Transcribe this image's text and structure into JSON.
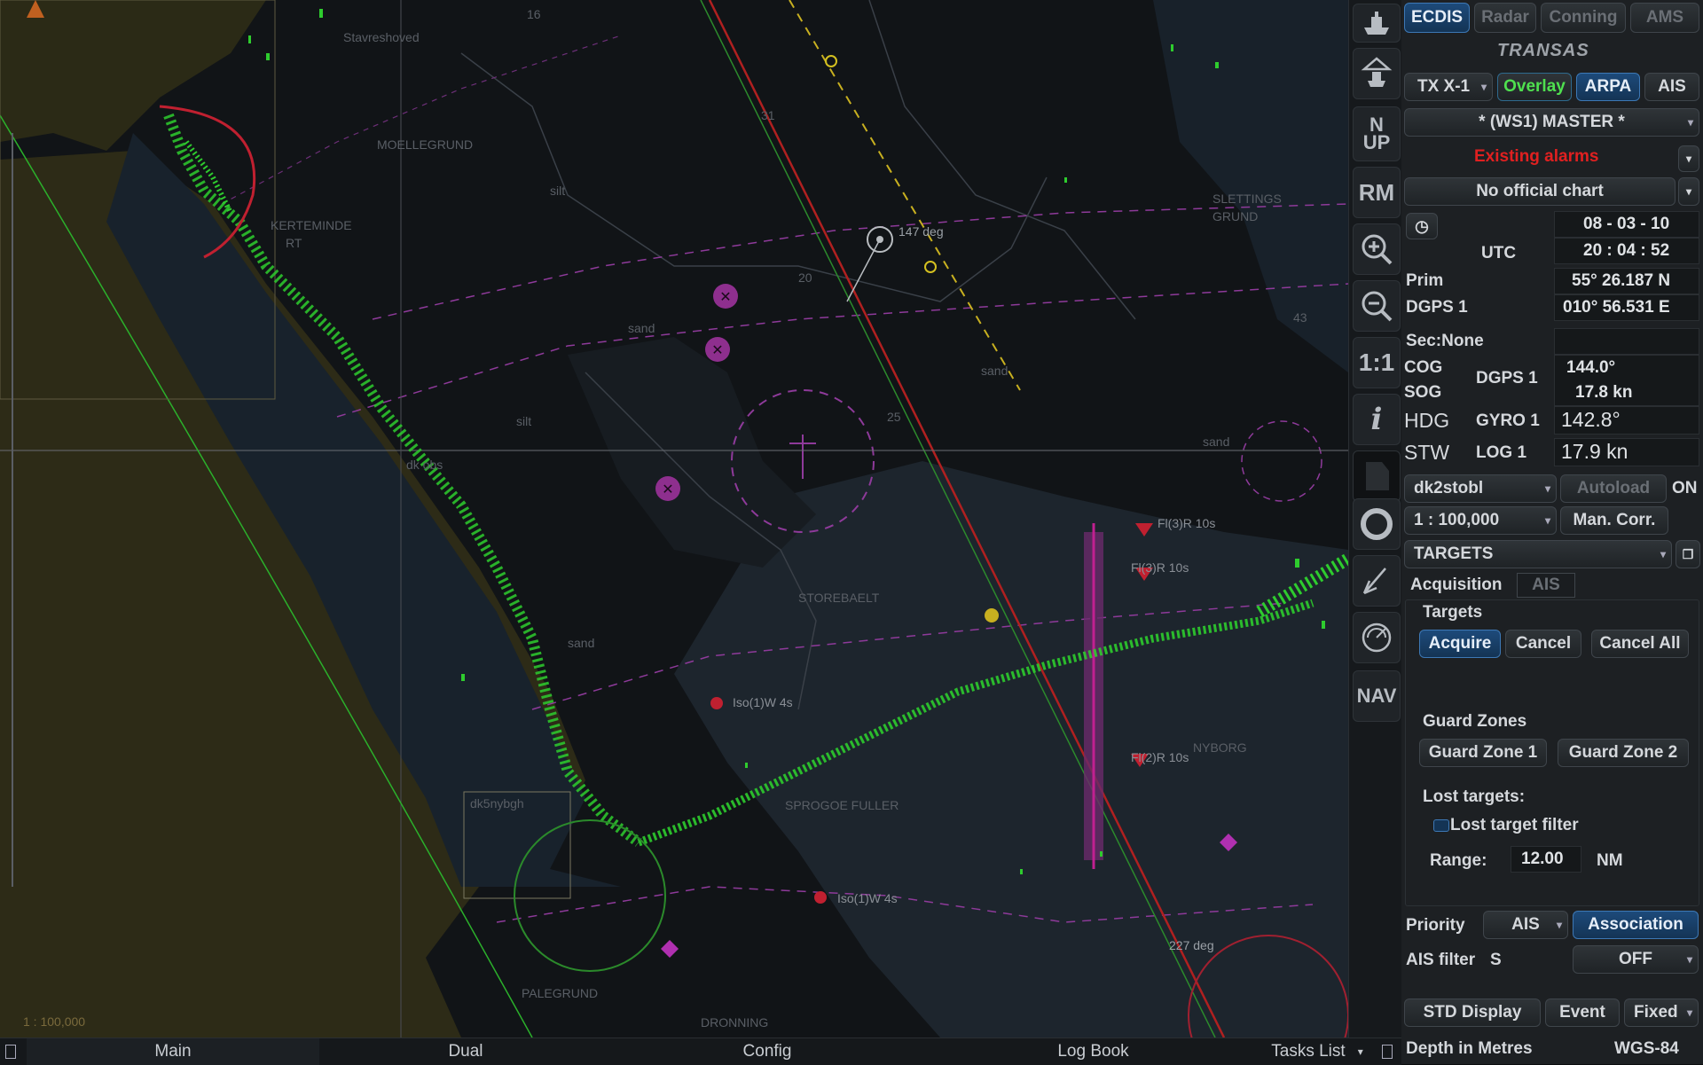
{
  "map": {
    "scale_text": "1 : 100,000",
    "labels": {
      "stavreshoved": "Stavreshoved",
      "moellegrund": "MOELLEGRUND",
      "kerteminde": "KERTEMINDE",
      "kerteminde_2": "RT",
      "silt1": "silt",
      "silt2": "silt",
      "sand1": "sand",
      "sand2": "sand",
      "sand3": "sand",
      "sand4": "sand",
      "storebaelt": "STOREBAELT",
      "sletting": "SLETTINGS",
      "sletting2": "GRUND",
      "dk_obs": "dk obs",
      "dk5nybgh": "dk5nybgh",
      "palegrund": "PALEGRUND",
      "dronning": "DRONNING",
      "deg147": "147 deg",
      "deg227": "227 deg",
      "nyeborg": "NYBORG",
      "sprogoe": "SPROGOE FULLER",
      "iso1": "Iso(1)W 4s",
      "iso2": "Iso(1)W 4s",
      "fl1": "Fl(3)R 10s",
      "fl2": "Fl(3)R 10s",
      "fl3": "Fl(2)R 10s",
      "depth_16": "16",
      "depth_31": "31",
      "depth_20": "20",
      "depth_25": "25",
      "depth_43": "43"
    }
  },
  "toolstrip": {
    "ship_icon": "ship-icon",
    "ship_home_icon": "ship-home-icon",
    "north_up": "N\nUP",
    "rm": "RM",
    "zoom_in_icon": "zoom-in-icon",
    "zoom_out_icon": "zoom-out-icon",
    "one_to_one": "1:1",
    "info": "i",
    "chart_icon": "chart-icon",
    "lifebuoy_icon": "lifebuoy-icon",
    "pencil_icon": "pencil-icon",
    "radar_icon": "radar-icon",
    "nav": "NAV"
  },
  "panel": {
    "modes": [
      "ECDIS",
      "Radar",
      "Conning",
      "AMS"
    ],
    "brand": "TRANSAS",
    "radar_source": "TX X-1",
    "overlay": "Overlay",
    "arpa": "ARPA",
    "ais": "AIS",
    "master": "* (WS1) MASTER *",
    "alarms": "Existing alarms",
    "chart_status": "No official chart",
    "date": "08 - 03 - 10",
    "utc_label": "UTC",
    "time": "20 : 04 : 52",
    "prim_label": "Prim",
    "lat": "55° 26.187 N",
    "dgps_label": "DGPS 1",
    "lon": "010° 56.531 E",
    "sec_label": "Sec:None",
    "cog_label": "COG",
    "sog_label": "SOG",
    "cogsog_src": "DGPS 1",
    "cog_val": "144.0°",
    "sog_val": "17.8 kn",
    "hdg_label": "HDG",
    "hdg_src": "GYRO 1",
    "hdg_val": "142.8°",
    "stw_label": "STW",
    "stw_src": "LOG 1",
    "stw_val": "17.9 kn",
    "chart_name": "dk2stobl",
    "autoload": "Autoload",
    "autoload_state": "ON",
    "scale": "1 : 100,000",
    "man_corr": "Man. Corr.",
    "targets_dd": "TARGETS",
    "tab_acq": "Acquisition",
    "tab_ais": "AIS",
    "targets_label": "Targets",
    "acquire": "Acquire",
    "cancel": "Cancel",
    "cancel_all": "Cancel All",
    "guard_label": "Guard Zones",
    "guard1": "Guard Zone 1",
    "guard2": "Guard Zone 2",
    "lost_label": "Lost targets:",
    "lost_filter": "Lost target filter",
    "range_label": "Range:",
    "range_val": "12.00",
    "range_unit": "NM",
    "priority_label": "Priority",
    "priority_val": "AIS",
    "association": "Association",
    "ais_filter_label": "AIS filter",
    "ais_filter_s": "S",
    "ais_filter_val": "OFF",
    "std_display": "STD Display",
    "event": "Event",
    "fixed": "Fixed",
    "depth_units": "Depth in Metres",
    "datum": "WGS-84"
  },
  "bottombar": {
    "tabs": [
      "Main",
      "Dual",
      "Config",
      "Log Book"
    ],
    "tasks": "Tasks List"
  },
  "colors": {
    "radar_echo": "#2ecc2e",
    "alarm_red": "#e0202a",
    "accent_blue": "#1d4a7a",
    "magenta": "#b03ab0"
  }
}
